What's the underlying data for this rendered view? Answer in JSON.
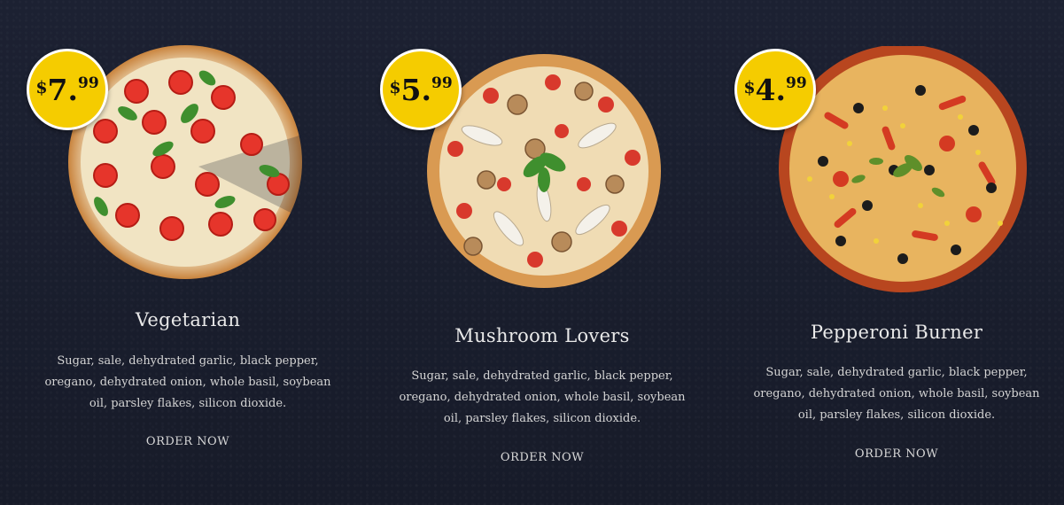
{
  "menu": {
    "items": [
      {
        "title": "Vegetarian",
        "price_currency": "$",
        "price_whole": "7",
        "price_cents": "99",
        "description": "Sugar, sale, dehydrated garlic, black pepper, oregano, dehydrated onion, whole basil, soybean oil, parsley flakes, silicon dioxide.",
        "order_label": "ORDER NOW"
      },
      {
        "title": "Mushroom Lovers",
        "price_currency": "$",
        "price_whole": "5",
        "price_cents": "99",
        "description": "Sugar, sale, dehydrated garlic, black pepper, oregano, dehydrated onion, whole basil, soybean oil, parsley flakes, silicon dioxide.",
        "order_label": "ORDER NOW"
      },
      {
        "title": "Pepperoni Burner",
        "price_currency": "$",
        "price_whole": "4",
        "price_cents": "99",
        "description": "Sugar, sale, dehydrated garlic, black pepper, oregano, dehydrated onion, whole basil, soybean oil, parsley flakes, silicon dioxide.",
        "order_label": "ORDER NOW"
      }
    ]
  },
  "colors": {
    "background": "#1b2030",
    "price_badge": "#f5cc00",
    "price_border": "#ffffff",
    "text": "#e6e6e6"
  },
  "icons": {
    "pizza_images": [
      "vegetarian-pizza-image",
      "mushroom-pizza-image",
      "pepperoni-pizza-image"
    ]
  }
}
